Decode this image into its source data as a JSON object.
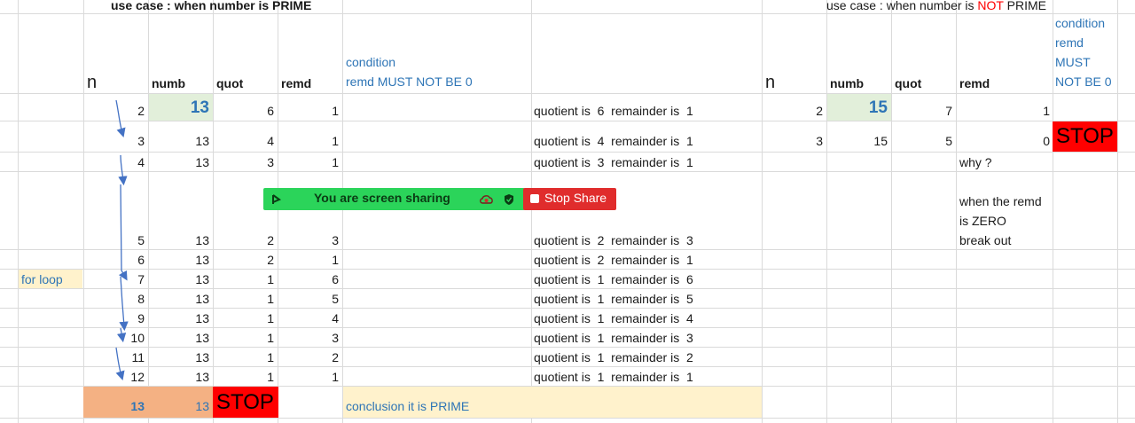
{
  "headers": {
    "prime_title": "use case : when number is PRIME",
    "notprime_title_prefix": "use case : when number is ",
    "notprime_title_not": "NOT",
    "notprime_title_suffix": " PRIME",
    "n": "n",
    "numb": "numb",
    "quot": "quot",
    "remd": "remd",
    "condition_line1": "condition",
    "condition_line2": "remd MUST NOT BE 0",
    "right_condition": [
      "condition",
      "remd",
      "MUST",
      "NOT BE 0"
    ]
  },
  "prime_rows": [
    {
      "n": "2",
      "numb": "13",
      "quot": "6",
      "remd": "1",
      "text": "quotient is  6  remainder is  1"
    },
    {
      "n": "3",
      "numb": "13",
      "quot": "4",
      "remd": "1",
      "text": "quotient is  4  remainder is  1"
    },
    {
      "n": "4",
      "numb": "13",
      "quot": "3",
      "remd": "1",
      "text": "quotient is  3  remainder is  1"
    },
    {
      "n": "5",
      "numb": "13",
      "quot": "2",
      "remd": "3",
      "text": "quotient is  2  remainder is  3"
    },
    {
      "n": "6",
      "numb": "13",
      "quot": "2",
      "remd": "1",
      "text": "quotient is  2  remainder is  1"
    },
    {
      "n": "7",
      "numb": "13",
      "quot": "1",
      "remd": "6",
      "text": "quotient is  1  remainder is  6"
    },
    {
      "n": "8",
      "numb": "13",
      "quot": "1",
      "remd": "5",
      "text": "quotient is  1  remainder is  5"
    },
    {
      "n": "9",
      "numb": "13",
      "quot": "1",
      "remd": "4",
      "text": "quotient is  1  remainder is  4"
    },
    {
      "n": "10",
      "numb": "13",
      "quot": "1",
      "remd": "3",
      "text": "quotient is  1  remainder is  3"
    },
    {
      "n": "11",
      "numb": "13",
      "quot": "1",
      "remd": "2",
      "text": "quotient is  1  remainder is  2"
    },
    {
      "n": "12",
      "numb": "13",
      "quot": "1",
      "remd": "1",
      "text": "quotient is  1  remainder is  1"
    }
  ],
  "final_row": {
    "n": "13",
    "numb": "13",
    "stop": "STOP",
    "conclusion": "conclusion it is PRIME"
  },
  "for_loop_label": "for loop",
  "notprime_rows": [
    {
      "n": "2",
      "numb": "15",
      "quot": "7",
      "remd": "1"
    },
    {
      "n": "3",
      "numb": "15",
      "quot": "5",
      "remd": "0",
      "stop": "STOP"
    }
  ],
  "notes": {
    "why": "why ?",
    "line1": "when the remd",
    "line2": "is ZERO",
    "line3": "break out"
  },
  "share": {
    "status": "You are screen sharing",
    "stop_label": "Stop Share"
  },
  "colors": {
    "grid": "#dadada",
    "header_blue": "#2e75b6",
    "numb_highlight": "#e2efda",
    "for_loop_bg": "#fff2cc",
    "conclusion_bg": "#fff2cc",
    "final_row_bg": "#f4b183",
    "stop_red": "#ff0000",
    "share_green": "#2bd45a",
    "share_red": "#e02c2c",
    "arrow": "#4472c4"
  }
}
